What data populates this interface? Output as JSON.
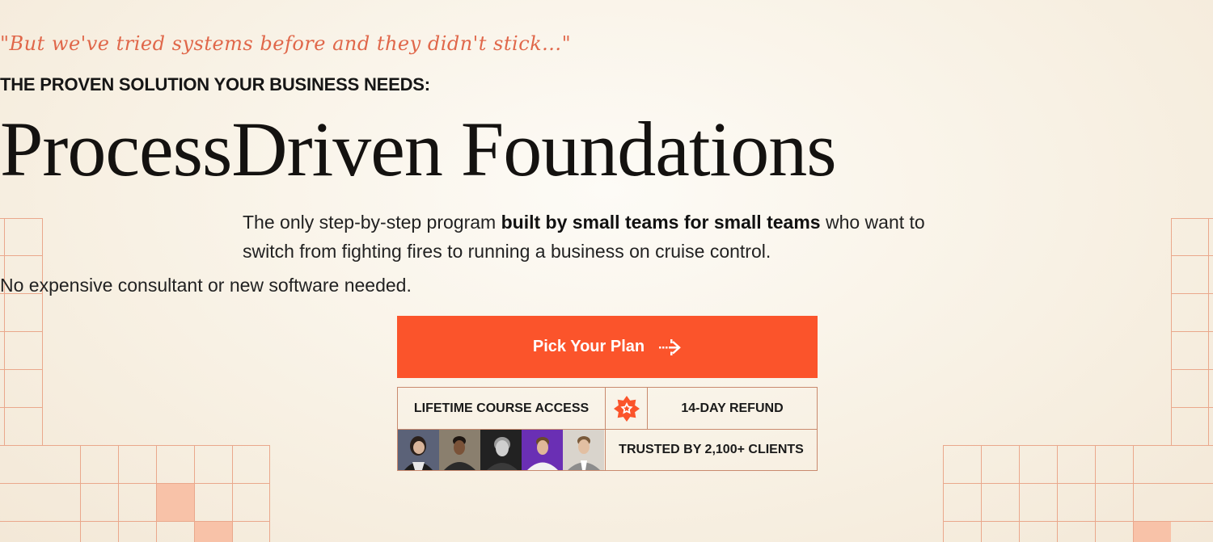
{
  "hero": {
    "tagline": "\"But we've tried systems before and they didn't stick...\"",
    "eyebrow": "THE PROVEN SOLUTION YOUR BUSINESS NEEDS:",
    "title": "ProcessDriven Foundations",
    "description_start": "The only step-by-step program ",
    "description_bold": "built by small teams for small teams",
    "description_end": " who want to switch from fighting fires to running a business on cruise control.",
    "subline": "No expensive consultant or new software needed."
  },
  "cta": {
    "label": "Pick Your Plan",
    "icon": "arrow-right-icon",
    "color": "#fb542b"
  },
  "badges": {
    "lifetime": "LIFETIME COURSE ACCESS",
    "star_icon": "star-badge-icon",
    "refund": "14-DAY REFUND",
    "trusted": "TRUSTED BY 2,100+ CLIENTS",
    "avatars": [
      "client-avatar-1",
      "client-avatar-2",
      "client-avatar-3",
      "client-avatar-4",
      "client-avatar-5"
    ]
  },
  "colors": {
    "accent": "#fb542b",
    "tagline": "#e0674a",
    "grid_line": "#e8a58a",
    "grid_fill": "#f8c2a8"
  }
}
